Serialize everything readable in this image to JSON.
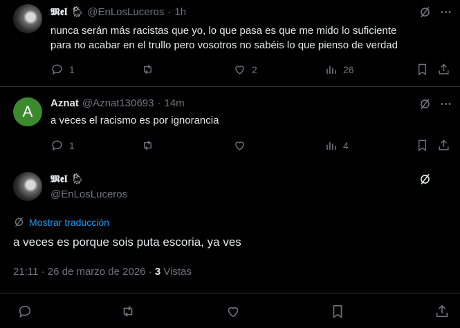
{
  "tweets": [
    {
      "display_name": "𝕸𝖊𝖑",
      "weather_emoji": "🌦",
      "handle": "@EnLosLuceros",
      "sep": "·",
      "time": "1h",
      "text_line1": "nunca serán más racistas que yo, lo que pasa es que me mido lo suficiente",
      "text_line2": "para no acabar en el trullo pero vosotros no sabéis lo que pienso de verdad",
      "replies": "1",
      "retweets": "",
      "likes": "2",
      "views": "26"
    },
    {
      "avatar_letter": "A",
      "display_name": "Aznat",
      "handle": "@Aznat130693",
      "sep": "·",
      "time": "14m",
      "text_line1": "a veces el racismo es por ignorancia",
      "replies": "1",
      "retweets": "",
      "likes": "",
      "views": "4"
    }
  ],
  "main_tweet": {
    "display_name": "𝕸𝖊𝖑",
    "weather_emoji": "🌦",
    "handle": "@EnLosLuceros",
    "translate_label": "Mostrar traducción",
    "text": "a veces es porque sois puta escoria, ya ves",
    "timestamp": "21:11 · 26 de marzo de 2026 ·",
    "views_count": "3",
    "views_label": "Vistas"
  },
  "colors": {
    "background": "#000000",
    "text": "#e7e9ea",
    "muted": "#71767b",
    "accent": "#1d9bf0",
    "avatar_green": "#3c8a2e"
  },
  "icons": [
    "grok-icon",
    "more-icon",
    "reply-icon",
    "retweet-icon",
    "like-icon",
    "views-icon",
    "bookmark-icon",
    "share-icon",
    "translate-icon"
  ]
}
